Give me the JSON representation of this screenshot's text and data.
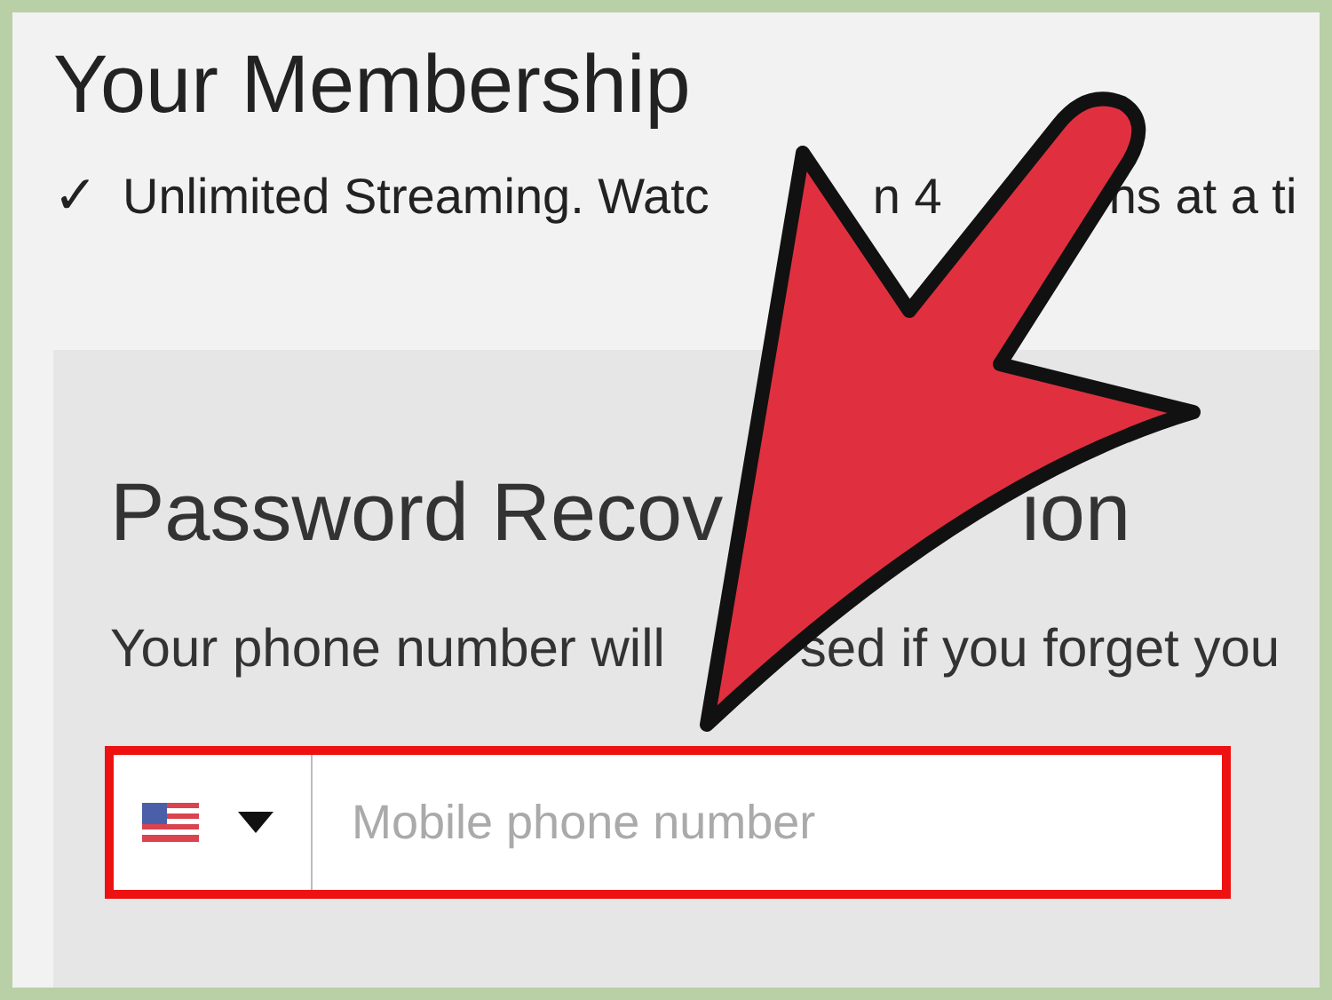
{
  "heading": "Your Membership",
  "plan": {
    "check": "✓",
    "segments": [
      "Unlimited Streaming. Watc",
      "n 4",
      "ns at a ti"
    ]
  },
  "recovery": {
    "title_segments": [
      "Password Recov",
      "ion"
    ],
    "description_segments": [
      "Your phone number will",
      "sed if you forget you"
    ],
    "phone_field": {
      "placeholder": "Mobile phone number",
      "highlighted": true
    }
  }
}
